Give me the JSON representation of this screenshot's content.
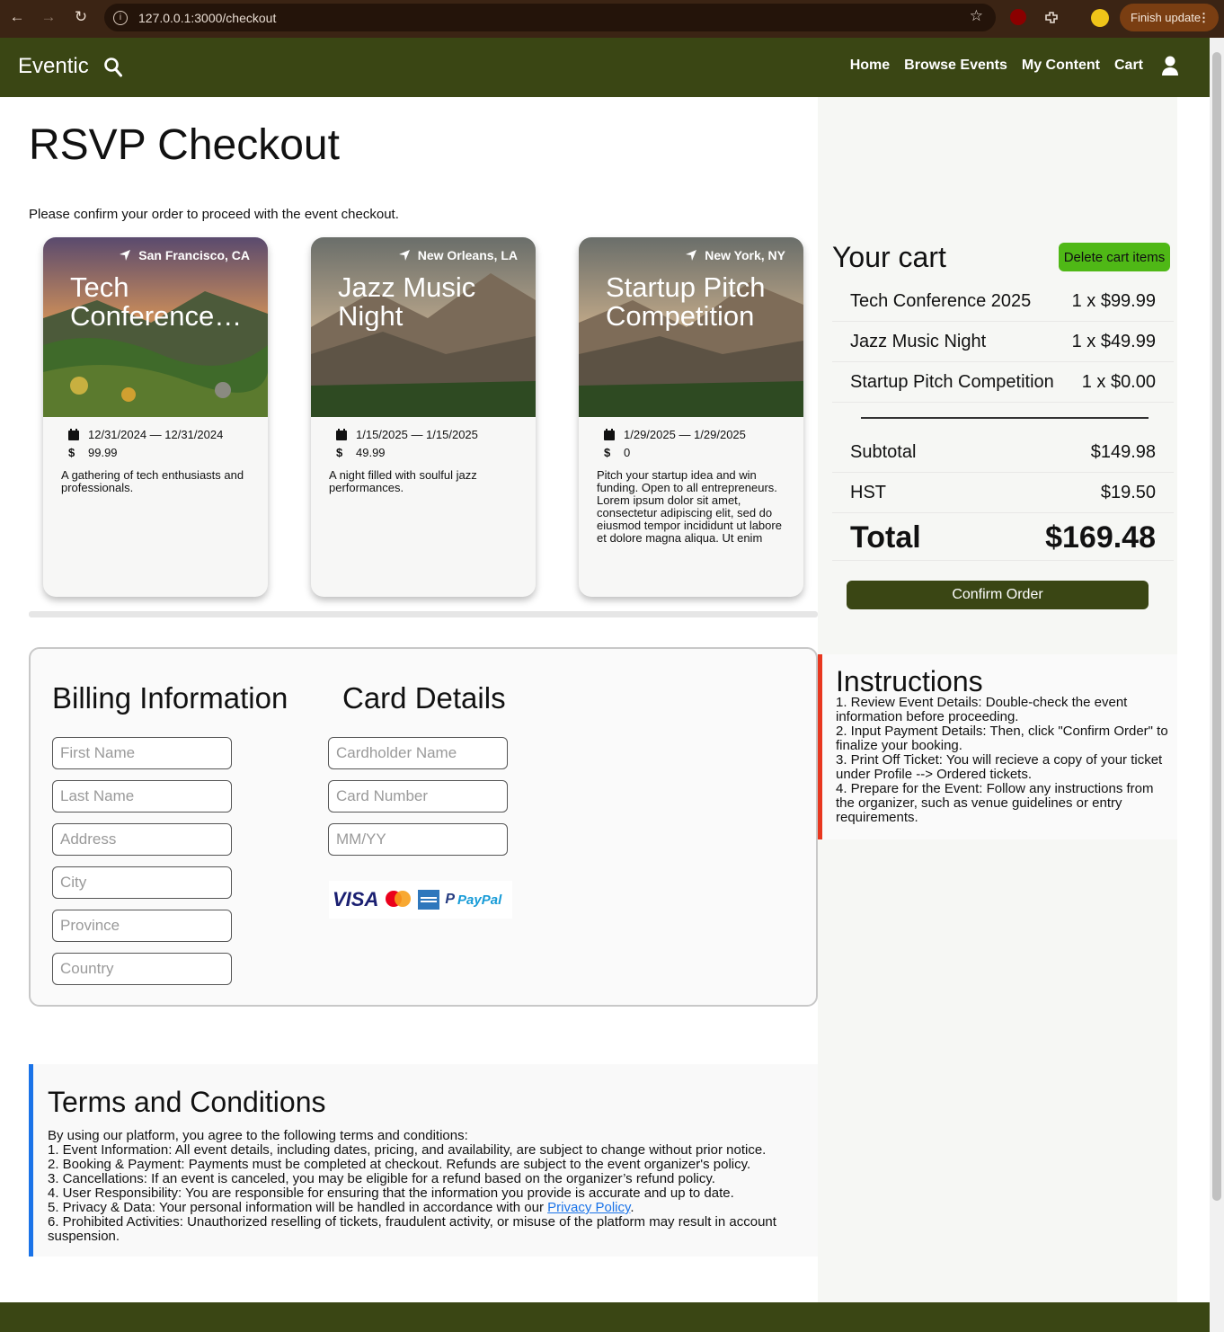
{
  "browser": {
    "url": "127.0.0.1:3000/checkout",
    "finish_update": "Finish update"
  },
  "header": {
    "brand": "Eventic",
    "nav": [
      "Home",
      "Browse Events",
      "My Content",
      "Cart"
    ]
  },
  "page": {
    "title": "RSVP Checkout",
    "subtitle": "Please confirm your order to proceed with the event checkout."
  },
  "events": [
    {
      "location": "San Francisco, CA",
      "title": "Tech Conference…",
      "dates": "12/31/2024 — 12/31/2024",
      "price": "99.99",
      "description": "A gathering of tech enthusiasts and professionals."
    },
    {
      "location": "New Orleans, LA",
      "title": "Jazz Music Night",
      "dates": "1/15/2025 — 1/15/2025",
      "price": "49.99",
      "description": "A night filled with soulful jazz performances."
    },
    {
      "location": "New York, NY",
      "title": "Startup Pitch Competition",
      "dates": "1/29/2025 — 1/29/2025",
      "price": "0",
      "description": "Pitch your startup idea and win funding. Open to all entrepreneurs. Lorem ipsum dolor sit amet, consectetur adipiscing elit, sed do eiusmod tempor incididunt ut labore et dolore magna aliqua. Ut enim ad…"
    }
  ],
  "billing": {
    "heading": "Billing Information",
    "fields": [
      "First Name",
      "Last Name",
      "Address",
      "City",
      "Province",
      "Country"
    ]
  },
  "card": {
    "heading": "Card Details",
    "fields": [
      "Cardholder Name",
      "Card Number",
      "MM/YY"
    ],
    "logos": [
      "VISA",
      "PayPal"
    ]
  },
  "terms": {
    "heading": "Terms and Conditions",
    "lines": [
      "By using our platform, you agree to the following terms and conditions:",
      "1. Event Information: All event details, including dates, pricing, and availability, are subject to change without prior notice.",
      "2. Booking & Payment: Payments must be completed at checkout. Refunds are subject to the event organizer's policy.",
      "3. Cancellations: If an event is canceled, you may be eligible for a refund based on the organizer’s refund policy.",
      "4. User Responsibility: You are responsible for ensuring that the information you provide is accurate and up to date."
    ],
    "privacy_prefix": "5. Privacy & Data: Your personal information will be handled in accordance with our ",
    "privacy_link": "Privacy Policy",
    "privacy_suffix": ".",
    "last_line": "6. Prohibited Activities: Unauthorized reselling of tickets, fraudulent activity, or misuse of the platform may result in account suspension."
  },
  "cart": {
    "heading": "Your cart",
    "delete_label": "Delete cart items",
    "items": [
      {
        "name": "Tech Conference 2025",
        "qty_price": "1 x $99.99"
      },
      {
        "name": "Jazz Music Night",
        "qty_price": "1 x $49.99"
      },
      {
        "name": "Startup Pitch Competition",
        "qty_price": "1 x $0.00"
      }
    ],
    "subtotal_label": "Subtotal",
    "subtotal": "$149.98",
    "tax_label": "HST",
    "tax": "$19.50",
    "total_label": "Total",
    "total": "$169.48",
    "confirm_label": "Confirm Order"
  },
  "instructions": {
    "heading": "Instructions",
    "lines": [
      "1. Review Event Details: Double-check the event information before proceeding.",
      "2. Input Payment Details: Then, click \"Confirm Order\" to finalize your booking.",
      "3. Print Off Ticket: You will recieve a copy of your ticket under Profile --> Ordered tickets.",
      "4. Prepare for the Event: Follow any instructions from the organizer, such as venue guidelines or entry requirements."
    ]
  },
  "colors": {
    "header_bg": "#3a4614",
    "delete_btn": "#4fb816",
    "instructions_accent": "#e8371f",
    "terms_accent": "#1a73e8"
  }
}
